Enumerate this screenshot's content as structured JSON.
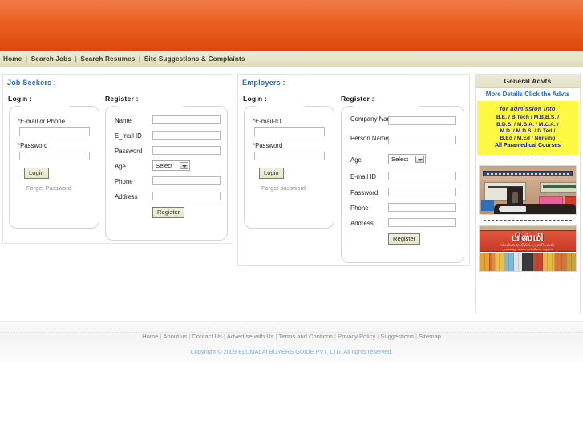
{
  "header": {
    "banner_color": "#e9561c"
  },
  "nav": {
    "items": [
      {
        "label": "Home"
      },
      {
        "label": "Search Jobs"
      },
      {
        "label": "Search Resumes"
      },
      {
        "label": "Site Suggestions & Complaints"
      }
    ],
    "separator": "|"
  },
  "jobseekers": {
    "title": "Job Seekers :",
    "login_heading": "Login :",
    "register_heading": "Register :",
    "login": {
      "email_label": "E-mail or Phone",
      "email_value": "",
      "password_label": "Password",
      "password_value": "",
      "login_button": "Login",
      "forget_link": "Forget Password",
      "required_marker": "*"
    },
    "register": {
      "fields": [
        {
          "label": "Name",
          "value": "",
          "type": "text"
        },
        {
          "label": "E_mail ID",
          "value": "",
          "type": "text"
        },
        {
          "label": "Password",
          "value": "",
          "type": "text"
        },
        {
          "label": "Age",
          "value": "Select",
          "type": "select"
        },
        {
          "label": "Phone",
          "value": "",
          "type": "text"
        },
        {
          "label": "Address",
          "value": "",
          "type": "text"
        }
      ],
      "register_button": "Register"
    }
  },
  "employers": {
    "title": "Employers :",
    "login_heading": "Login :",
    "register_heading": "Register :",
    "login": {
      "email_label": "E-mail-ID",
      "email_value": "",
      "password_label": "Password",
      "password_value": "",
      "login_button": "Login",
      "forget_link": "Forget password",
      "required_marker": "*"
    },
    "register": {
      "fields": [
        {
          "label": "Company Name",
          "value": "",
          "type": "text"
        },
        {
          "label": "Person Name",
          "value": "",
          "type": "text"
        },
        {
          "label": "Age",
          "value": "Select",
          "type": "select"
        },
        {
          "label": "E-mail ID",
          "value": "",
          "type": "text"
        },
        {
          "label": "Password",
          "value": "",
          "type": "text"
        },
        {
          "label": "Phone",
          "value": "",
          "type": "text"
        },
        {
          "label": "Address",
          "value": "",
          "type": "text"
        }
      ],
      "register_button": "Register"
    }
  },
  "sidebar": {
    "heading": "General Advts",
    "subheading": "More Details Click the Advts",
    "yellow_ad": {
      "title": "for admission into",
      "lines": [
        "B.E. / B.Tech / M.B.B.S. /",
        "B.D.S. / M.B.A. / M.C.A. /",
        "M.D. / M.D.S. / D.Ted /",
        "B.Ed / M.Ed / Nursing"
      ],
      "last_line": "All Paramedical Courses",
      "background": "#fdf943",
      "text_color": "#1d1d9c"
    },
    "photo_ad_1": {
      "caption": "shop storefront advertisement"
    },
    "photo_ad_2": {
      "title": "பிஸ்மி",
      "sub": "சென்னை சில்க் அணிகலன்",
      "sub2": "அனைத்து வகை மலிவிலை சலுகை"
    }
  },
  "footer": {
    "links": [
      {
        "label": "Home"
      },
      {
        "label": "About us"
      },
      {
        "label": "Contact Us"
      },
      {
        "label": "Advertise with Us"
      },
      {
        "label": "Terms and Contions"
      },
      {
        "label": "Privacy Policy"
      },
      {
        "label": "Suggestions"
      },
      {
        "label": "Sitemap"
      }
    ],
    "separator": "|",
    "copyright": "Copyright © 2009 ELUMALAI BUYERS GUIDE PVT. LTD. All rights reserved."
  }
}
